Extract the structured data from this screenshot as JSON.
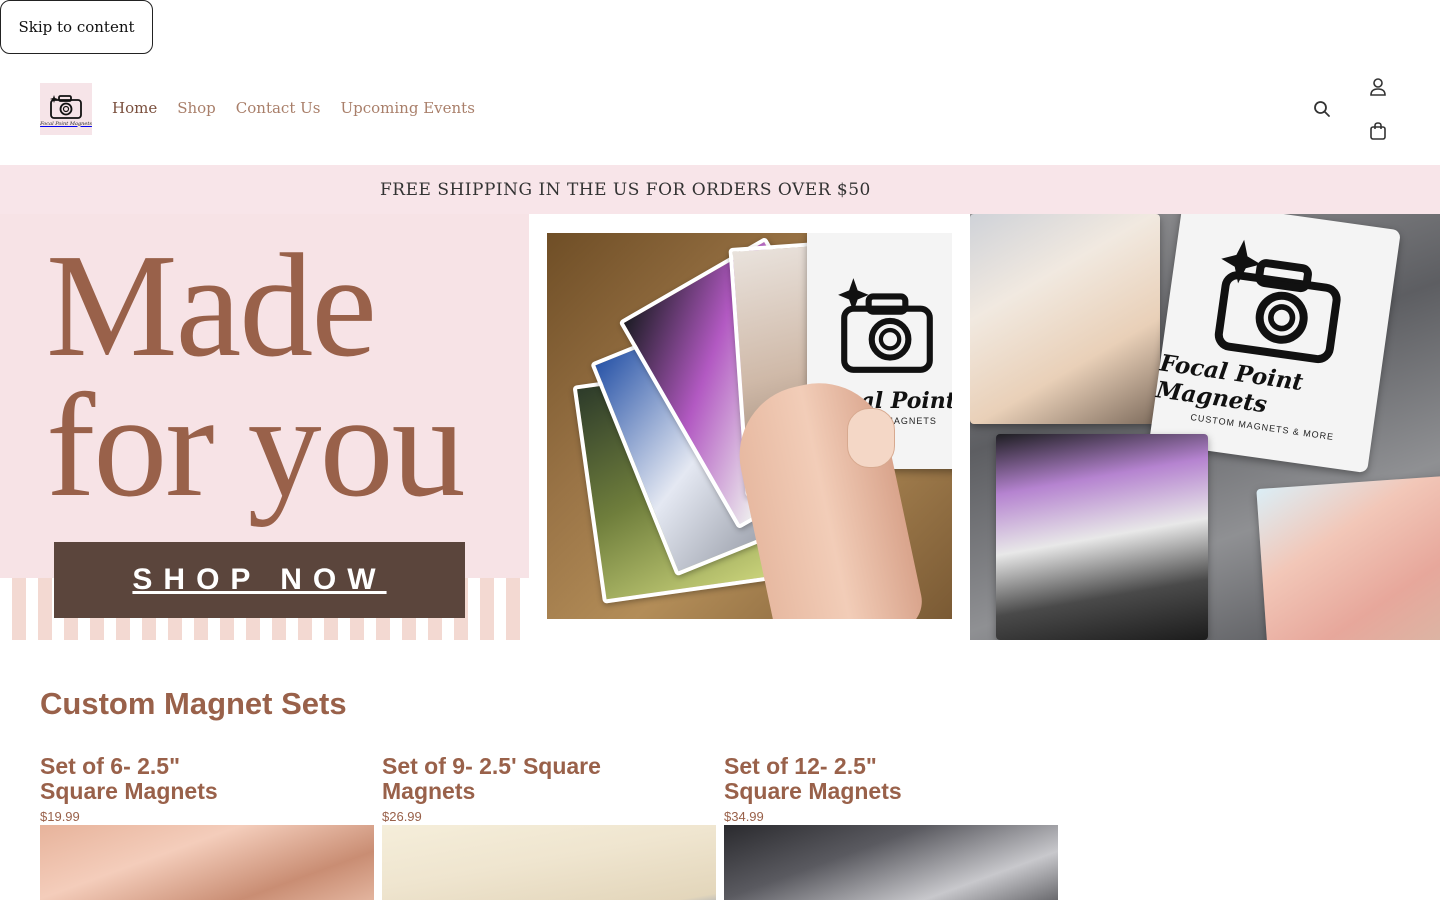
{
  "skip_link": {
    "label": "Skip to content"
  },
  "header": {
    "logo_text": "Focal Point Magnets",
    "nav": [
      {
        "label": "Home",
        "active": true
      },
      {
        "label": "Shop",
        "active": false
      },
      {
        "label": "Contact Us",
        "active": false
      },
      {
        "label": "Upcoming Events",
        "active": false
      }
    ],
    "icons": [
      "search-icon",
      "account-icon",
      "cart-icon"
    ]
  },
  "announcement": {
    "text": "FREE SHIPPING IN THE US FOR ORDERS OVER $50"
  },
  "hero": {
    "headline_line1": "Made",
    "headline_line2": "for you",
    "cta_label": "SHOP NOW",
    "magnet_brand": "Focal Point Magnets",
    "magnet_sub": "CUSTOM MAGNETS & MORE",
    "magnet_brand_short": "Focal Point",
    "magnet_sub_short": "CUSTOM MAGNETS"
  },
  "collection": {
    "title": "Custom Magnet Sets",
    "products": [
      {
        "title": "Set of 6- 2.5\" Square Magnets",
        "price": "$19.99"
      },
      {
        "title": "Set of 9- 2.5' Square Magnets",
        "price": "$26.99"
      },
      {
        "title": "Set of 12- 2.5\" Square Magnets",
        "price": "$34.99"
      }
    ]
  },
  "colors": {
    "accent": "#99614a",
    "nav_text": "#a97f6a",
    "announcement_bg": "#f8e5e9",
    "cta_bg": "#5b453c"
  }
}
